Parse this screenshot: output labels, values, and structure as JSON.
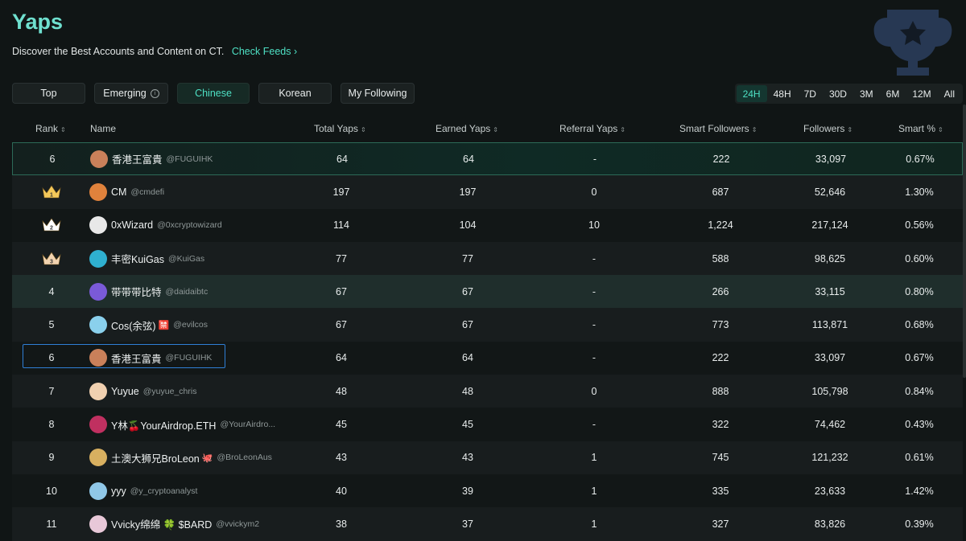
{
  "header": {
    "title": "Yaps",
    "subtitle": "Discover the Best Accounts and Content on CT.",
    "check_feeds": "Check Feeds ›"
  },
  "tabs": [
    {
      "label": "Top",
      "active": false
    },
    {
      "label": "Emerging",
      "active": false
    },
    {
      "label": "Chinese",
      "active": true
    },
    {
      "label": "Korean",
      "active": false
    },
    {
      "label": "My Following",
      "active": false
    }
  ],
  "periods": [
    "24H",
    "48H",
    "7D",
    "30D",
    "3M",
    "6M",
    "12M",
    "All"
  ],
  "active_period": "24H",
  "columns": {
    "rank": "Rank",
    "name": "Name",
    "total": "Total Yaps",
    "earned": "Earned Yaps",
    "referral": "Referral Yaps",
    "smart": "Smart Followers",
    "followers": "Followers",
    "pct": "Smart %"
  },
  "rows": [
    {
      "rank": "6",
      "name": "香港王富貴",
      "handle": "@FUGUIHK",
      "total": "64",
      "earned": "64",
      "referral": "-",
      "smart": "222",
      "followers": "33,097",
      "pct": "0.67%",
      "avatar_color": "#c9805a"
    },
    {
      "rank": "1",
      "name": "CM",
      "handle": "@cmdefi",
      "total": "197",
      "earned": "197",
      "referral": "0",
      "smart": "687",
      "followers": "52,646",
      "pct": "1.30%",
      "avatar_color": "#e0823c"
    },
    {
      "rank": "2",
      "name": "0xWizard",
      "handle": "@0xcryptowizard",
      "total": "114",
      "earned": "104",
      "referral": "10",
      "smart": "1,224",
      "followers": "217,124",
      "pct": "0.56%",
      "avatar_color": "#e8e8e8"
    },
    {
      "rank": "3",
      "name": "丰密KuiGas",
      "handle": "@KuiGas",
      "total": "77",
      "earned": "77",
      "referral": "-",
      "smart": "588",
      "followers": "98,625",
      "pct": "0.60%",
      "avatar_color": "#2fb0d0"
    },
    {
      "rank": "4",
      "name": "带带带比特",
      "handle": "@daidaibtc",
      "total": "67",
      "earned": "67",
      "referral": "-",
      "smart": "266",
      "followers": "33,115",
      "pct": "0.80%",
      "avatar_color": "#7a5ad8"
    },
    {
      "rank": "5",
      "name": "Cos(余弦)",
      "handle": "@evilcos",
      "total": "67",
      "earned": "67",
      "referral": "-",
      "smart": "773",
      "followers": "113,871",
      "pct": "0.68%",
      "avatar_color": "#8ad0ec",
      "emoji": "🈲"
    },
    {
      "rank": "6",
      "name": "香港王富貴",
      "handle": "@FUGUIHK",
      "total": "64",
      "earned": "64",
      "referral": "-",
      "smart": "222",
      "followers": "33,097",
      "pct": "0.67%",
      "avatar_color": "#c9805a"
    },
    {
      "rank": "7",
      "name": "Yuyue",
      "handle": "@yuyue_chris",
      "total": "48",
      "earned": "48",
      "referral": "0",
      "smart": "888",
      "followers": "105,798",
      "pct": "0.84%",
      "avatar_color": "#f0d0b0"
    },
    {
      "rank": "8",
      "name": "Y林🍒YourAirdrop.ETH",
      "handle": "@YourAirdro...",
      "total": "45",
      "earned": "45",
      "referral": "-",
      "smart": "322",
      "followers": "74,462",
      "pct": "0.43%",
      "avatar_color": "#c03060"
    },
    {
      "rank": "9",
      "name": "土澳大狮兄BroLeon",
      "handle": "@BroLeonAus",
      "total": "43",
      "earned": "43",
      "referral": "1",
      "smart": "745",
      "followers": "121,232",
      "pct": "0.61%",
      "avatar_color": "#d8b060",
      "emoji": "🐙"
    },
    {
      "rank": "10",
      "name": "yyy",
      "handle": "@y_cryptoanalyst",
      "total": "40",
      "earned": "39",
      "referral": "1",
      "smart": "335",
      "followers": "23,633",
      "pct": "1.42%",
      "avatar_color": "#90c8e8"
    },
    {
      "rank": "11",
      "name": "Vvicky绵绵 🍀 $BARD",
      "handle": "@vvickym2",
      "total": "38",
      "earned": "37",
      "referral": "1",
      "smart": "327",
      "followers": "83,826",
      "pct": "0.39%",
      "avatar_color": "#e8c8d8"
    }
  ]
}
